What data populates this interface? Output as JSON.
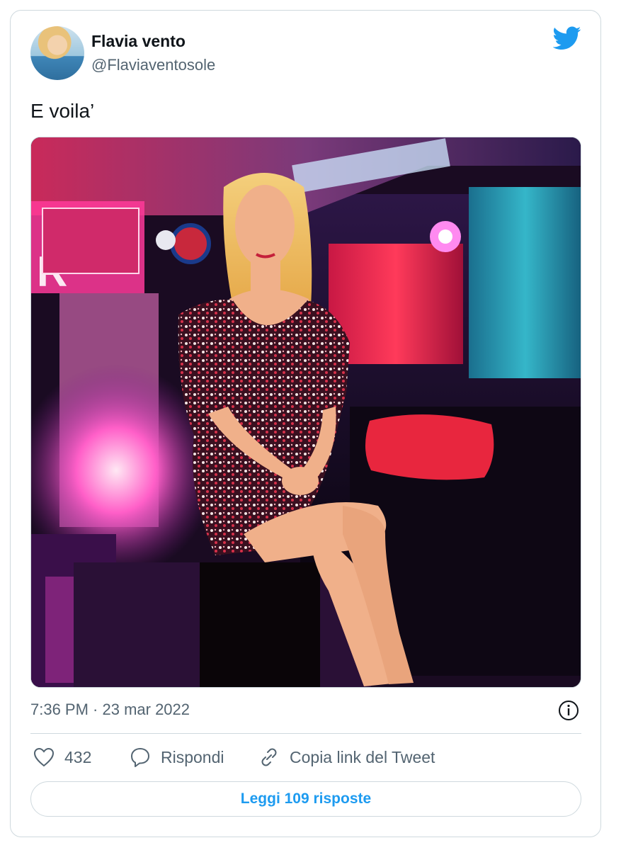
{
  "author": {
    "display_name": "Flavia vento",
    "handle": "@Flaviaventosole"
  },
  "tweet": {
    "text": "E voila’",
    "timestamp": "7:36 PM · 23 mar 2022",
    "media_icon": "photo"
  },
  "actions": {
    "like_count": "432",
    "reply_label": "Rispondi",
    "copy_link_label": "Copia link del Tweet"
  },
  "read_replies_label": "Leggi 109 risposte",
  "icons": {
    "brand": "twitter-bird-icon",
    "info": "info-icon",
    "like": "heart-icon",
    "reply": "speech-bubble-icon",
    "copy": "link-icon"
  },
  "colors": {
    "accent": "#1d9bf0",
    "secondary_text": "#536471",
    "border": "#cfd9de"
  }
}
